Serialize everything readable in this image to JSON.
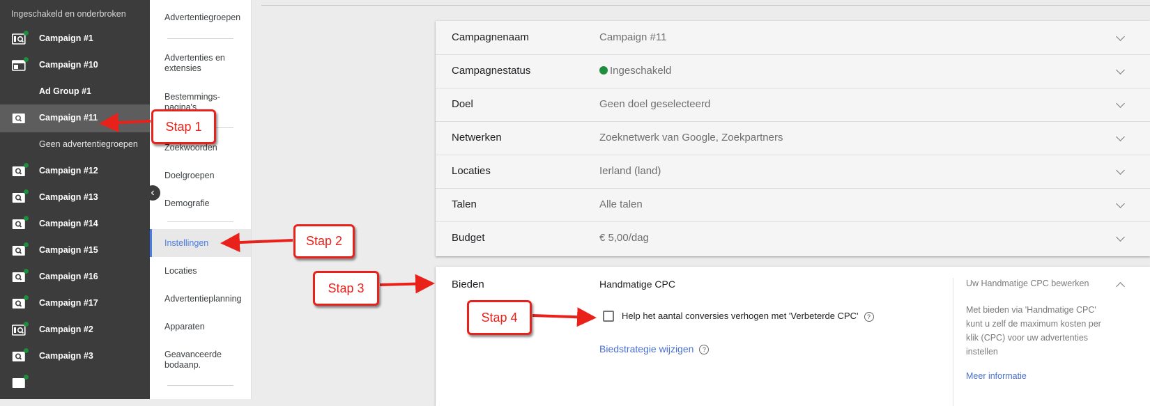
{
  "sidebar": {
    "header": "Ingeschakeld en onderbroken",
    "campaigns": [
      {
        "label": "Campaign #1",
        "icon": "display-search-icon",
        "status_dot": true
      },
      {
        "label": "Campaign #10",
        "icon": "display-icon",
        "status_dot": true
      },
      {
        "label": "Ad Group #1",
        "icon": "",
        "status_dot": false
      },
      {
        "label": "Campaign #11",
        "icon": "search-icon",
        "status_dot": false,
        "selected": true
      },
      {
        "label": "Geen advertentiegroepen",
        "icon": "",
        "status_dot": false
      },
      {
        "label": "Campaign #12",
        "icon": "search-icon",
        "status_dot": true
      },
      {
        "label": "Campaign #13",
        "icon": "search-icon",
        "status_dot": true
      },
      {
        "label": "Campaign #14",
        "icon": "search-icon",
        "status_dot": true
      },
      {
        "label": "Campaign #15",
        "icon": "search-icon",
        "status_dot": true
      },
      {
        "label": "Campaign #16",
        "icon": "search-icon",
        "status_dot": true
      },
      {
        "label": "Campaign #17",
        "icon": "search-icon",
        "status_dot": true
      },
      {
        "label": "Campaign #2",
        "icon": "display-search-icon",
        "status_dot": true
      },
      {
        "label": "Campaign #3",
        "icon": "search-icon",
        "status_dot": true
      }
    ],
    "collapse_icon": "chevron-left-icon"
  },
  "nav": {
    "items": [
      {
        "label": "Advertentiegroepen"
      },
      {
        "label": "Advertenties en extensies"
      },
      {
        "label": "Bestemmings-pagina's"
      },
      {
        "label": "Zoekwoorden"
      },
      {
        "label": "Doelgroepen"
      },
      {
        "label": "Demografie"
      },
      {
        "label": "Instellingen",
        "active": true
      },
      {
        "label": "Locaties"
      },
      {
        "label": "Advertentieplanning"
      },
      {
        "label": "Apparaten"
      },
      {
        "label": "Geavanceerde bodaanp."
      }
    ]
  },
  "settings": {
    "rows": [
      {
        "label": "Campagnenaam",
        "value": "Campaign #11"
      },
      {
        "label": "Campagnestatus",
        "value": "Ingeschakeld",
        "status_color": "#1e8e3e"
      },
      {
        "label": "Doel",
        "value": "Geen doel geselecteerd"
      },
      {
        "label": "Netwerken",
        "value": "Zoeknetwerk van Google, Zoekpartners"
      },
      {
        "label": "Locaties",
        "value": "Ierland (land)"
      },
      {
        "label": "Talen",
        "value": "Alle talen"
      },
      {
        "label": "Budget",
        "value": "€ 5,00/dag"
      }
    ]
  },
  "bidding": {
    "label": "Bieden",
    "strategy": "Handmatige CPC",
    "checkbox_label": "Help het aantal conversies verhogen met 'Verbeterde CPC'",
    "checkbox_checked": false,
    "change_link": "Biedstrategie wijzigen",
    "side_title": "Uw Handmatige CPC bewerken",
    "side_text": "Met bieden via 'Handmatige CPC' kunt u zelf de maximum kosten per klik (CPC) voor uw advertenties instellen",
    "side_link": "Meer informatie"
  },
  "annotations": [
    {
      "text": "Stap 1"
    },
    {
      "text": "Stap 2"
    },
    {
      "text": "Stap 3"
    },
    {
      "text": "Stap 4"
    }
  ],
  "colors": {
    "annotation": "#e8221b",
    "link": "#4a6fd1",
    "active_nav": "#4a7ee6",
    "status_green": "#1e8e3e"
  }
}
